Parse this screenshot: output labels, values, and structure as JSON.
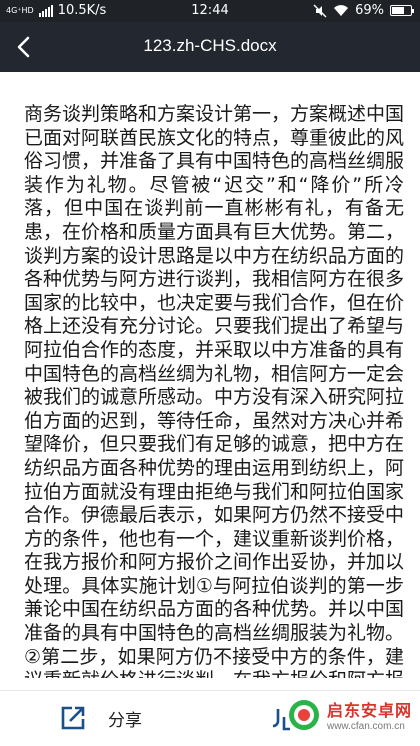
{
  "status": {
    "net_label": "4G⁺HD",
    "speed": "10.5K/s",
    "time": "12:44",
    "battery_text": "69%",
    "battery_level": 0.69
  },
  "header": {
    "title": "123.zh-CHS.docx"
  },
  "document": {
    "body": "商务谈判策略和方案设计第一，方案概述中国已面对阿联酋民族文化的特点，尊重彼此的风俗习惯，并准备了具有中国特色的高档丝绸服装作为礼物。尽管被“迟交”和“降价”所冷落，但中国在谈判前一直彬彬有礼，有备无患，在价格和质量方面具有巨大优势。第二，谈判方案的设计思路是以中方在纺织品方面的各种优势与阿方进行谈判，我相信阿方在很多国家的比较中，也决定要与我们合作，但在价格上还没有充分讨论。只要我们提出了希望与阿拉伯合作的态度，并采取以中方准备的具有中国特色的高档丝绸为礼物，相信阿方一定会被我们的诚意所感动。中方没有深入研究阿拉伯方面的迟到，等待任命，虽然对方决心并希望降价，但只要我们有足够的诚意，把中方在纺织品方面各种优势的理由运用到纺织上，阿拉伯方面就没有理由拒绝与我们和阿拉伯国家合作。伊德最后表示，如果阿方仍然不接受中方的条件，他也有一个，建议重新谈判价格，在我方报价和阿方报价之间作出妥协，并加以处理。具体实施计划①与阿拉伯谈判的第一步兼论中国在纺织品方面的各种优势。并以中国准备的具有中国特色的高档丝绸服装为礼物。②第二步，如果阿方仍不接受中方的条件，建议重新就价格进行谈判，在我方报价和阿方报价之间作出妥协，并予以处理。"
  },
  "bottom": {
    "share_label": "分享",
    "watermark_title": "启东安卓网",
    "watermark_url": "www.cfan.com.cn"
  },
  "colors": {
    "status_bg": "#1f2327",
    "title_bg": "#232830",
    "accent_blue": "#1a4f8a",
    "watermark_red": "#d9342b"
  },
  "icons": [
    "back-arrow-icon",
    "share-icon",
    "document-icon",
    "watermark-logo-icon",
    "wifi-icon",
    "battery-icon",
    "mute-icon",
    "signal-icon"
  ]
}
